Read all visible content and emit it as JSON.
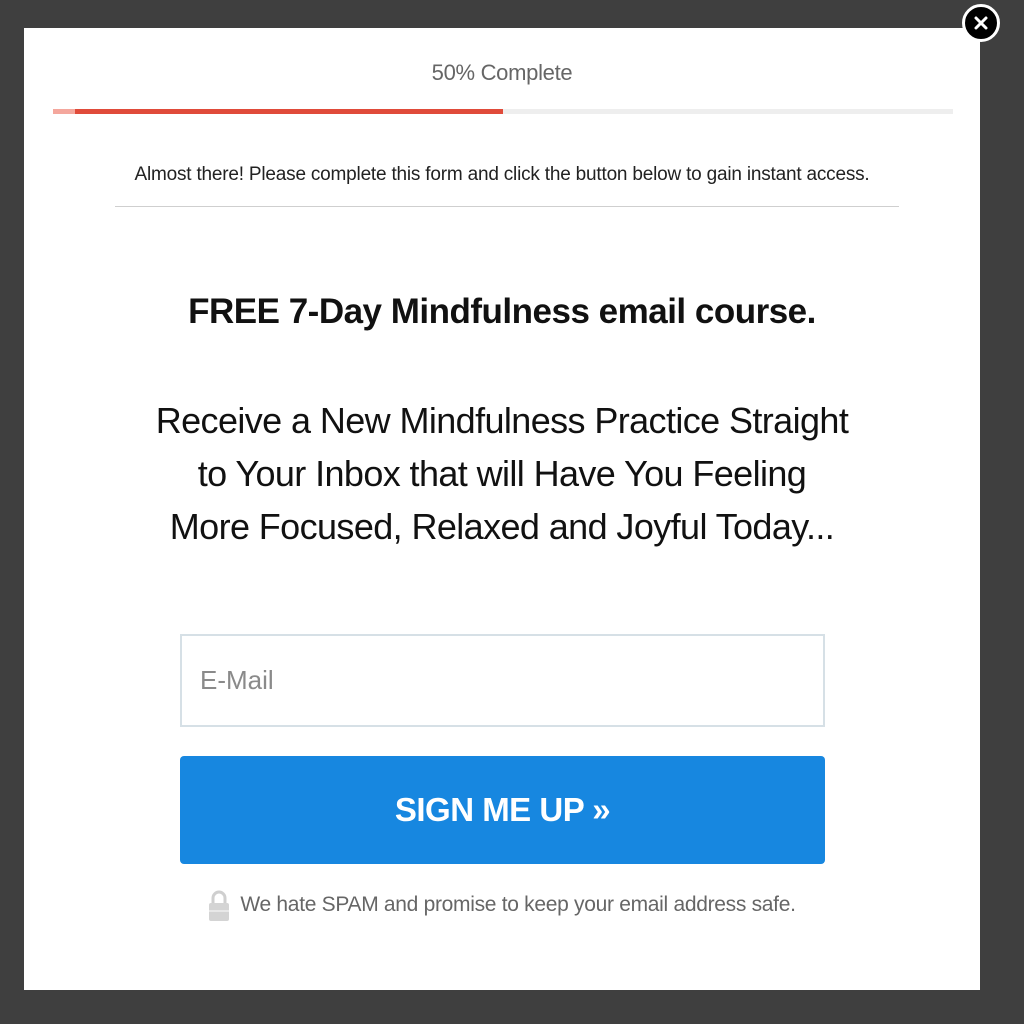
{
  "progress": {
    "label": "50% Complete",
    "percent": 50,
    "color": "#e04b3a"
  },
  "intro_text": "Almost there! Please complete this form and click the button below to gain instant access.",
  "headline": "FREE 7-Day Mindfulness email course.",
  "subheadline": "Receive a New Mindfulness Practice Straight to Your Inbox that will Have You Feeling More Focused, Relaxed and Joyful Today...",
  "email_field": {
    "placeholder": "E-Mail",
    "value": ""
  },
  "signup_button": {
    "label": "SIGN ME UP »",
    "color": "#1787e0"
  },
  "spam_note": {
    "text": "We hate SPAM and promise to keep your email address safe.",
    "icon": "lock-icon"
  },
  "close_button": {
    "icon": "close-icon"
  },
  "colors": {
    "overlay": "#3f3f3f",
    "modal": "#ffffff"
  }
}
